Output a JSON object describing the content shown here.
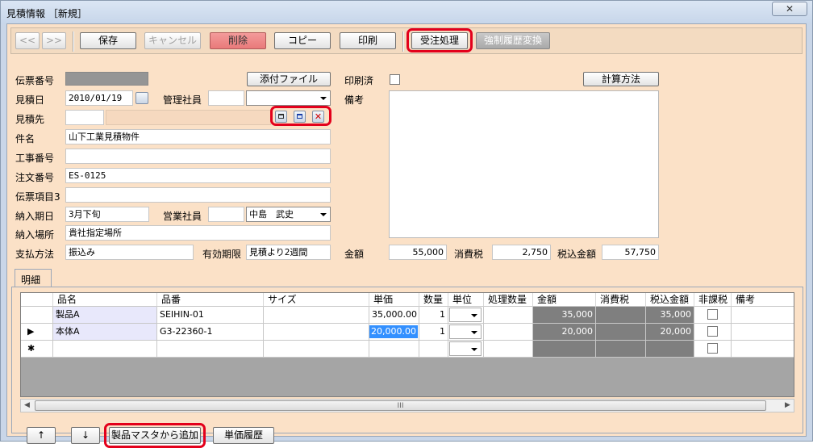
{
  "window": {
    "title": "見積情報 ［新規］",
    "close_glyph": "✕"
  },
  "toolbar": {
    "prev": "<<",
    "next": ">>",
    "save": "保存",
    "cancel": "キャンセル",
    "delete": "削除",
    "copy": "コピー",
    "print": "印刷",
    "order": "受注処理",
    "force_convert": "強制履歴変換"
  },
  "form": {
    "slip_no_label": "伝票番号",
    "slip_no": "",
    "attach_button": "添付ファイル",
    "printed_label": "印刷済",
    "calc_button": "計算方法",
    "est_date_label": "見積日",
    "est_date": "2010/01/19",
    "manager_label": "管理社員",
    "manager_code": "",
    "manager_name": "",
    "remarks_label": "備考",
    "dest_label": "見積先",
    "dest_code": "",
    "dest_name": "",
    "item_label": "件名",
    "item": "山下工業見積物件",
    "work_no_label": "工事番号",
    "work_no": "",
    "order_no_label": "注文番号",
    "order_no": "ES-0125",
    "slip3_label": "伝票項目3",
    "slip3": "",
    "delivery_label": "納入期日",
    "delivery": "3月下旬",
    "sales_label": "営業社員",
    "sales_code": "",
    "sales_name": "中島　武史",
    "place_label": "納入場所",
    "place": "貴社指定場所",
    "payment_label": "支払方法",
    "payment": "振込み",
    "valid_label": "有効期限",
    "valid": "見積より2週間",
    "amount_label": "金額",
    "amount": "55,000",
    "tax_label": "消費税",
    "tax": "2,750",
    "total_label": "税込金額",
    "total": "57,750"
  },
  "detail": {
    "tab": "明細",
    "columns": [
      "品名",
      "品番",
      "サイズ",
      "単価",
      "数量",
      "単位",
      "処理数量",
      "金額",
      "消費税",
      "税込金額",
      "非課税",
      "備考"
    ],
    "rows": [
      {
        "marker": "",
        "name": "製品A",
        "code": "SEIHIN-01",
        "size": "",
        "price": "35,000.00",
        "qty": "1",
        "unit": "",
        "proc": "",
        "amount": "35,000",
        "tax": "",
        "total": "35,000"
      },
      {
        "marker": "▶",
        "name": "本体A",
        "code": "G3-22360-1",
        "size": "",
        "price": "20,000.00",
        "qty": "1",
        "unit": "",
        "proc": "",
        "amount": "20,000",
        "tax": "",
        "total": "20,000"
      },
      {
        "marker": "✱",
        "name": "",
        "code": "",
        "size": "",
        "price": "",
        "qty": "",
        "unit": "",
        "proc": "",
        "amount": "",
        "tax": "",
        "total": ""
      }
    ],
    "scroll_grip": "III",
    "up": "↑",
    "down": "↓",
    "add_from_master": "製品マスタから追加",
    "price_history": "単価履歴"
  }
}
